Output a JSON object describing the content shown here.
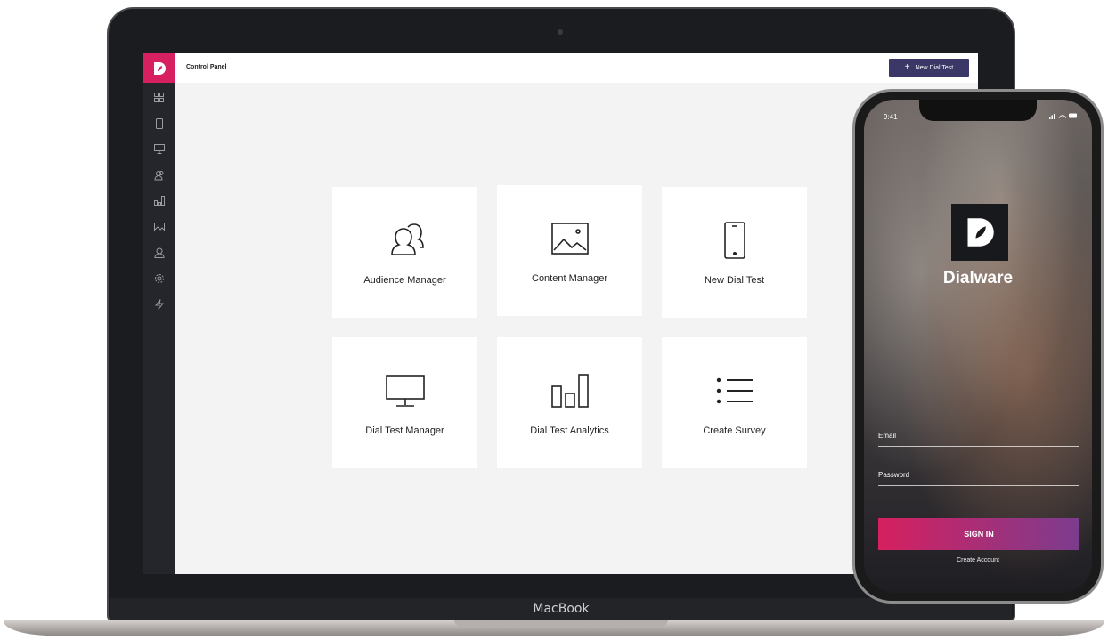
{
  "laptop": {
    "brand_label": "MacBook"
  },
  "app": {
    "header": {
      "title": "Control Panel",
      "new_button_label": "New Dial Test",
      "new_button_icon": "plus-icon"
    },
    "sidebar": {
      "logo_icon": "dialware-logo-icon",
      "icons": [
        "grid-icon",
        "phone-icon",
        "monitor-icon",
        "audience-icon",
        "bar-chart-icon",
        "image-icon",
        "user-icon",
        "gear-icon",
        "bolt-icon"
      ]
    },
    "cards": [
      {
        "label": "Audience Manager",
        "icon": "audience-icon"
      },
      {
        "label": "Content Manager",
        "icon": "image-icon"
      },
      {
        "label": "New Dial Test",
        "icon": "phone-icon"
      },
      {
        "label": "Dial Test Manager",
        "icon": "monitor-icon"
      },
      {
        "label": "Dial Test Analytics",
        "icon": "bar-chart-icon"
      },
      {
        "label": "Create Survey",
        "icon": "list-icon"
      }
    ],
    "colors": {
      "brand": "#d6205f",
      "sidebar": "#25262b",
      "button": "#3b3766",
      "signin_gradient_end": "#7b3c8e"
    }
  },
  "phone": {
    "status_time": "9:41",
    "app_name": "Dialware",
    "email_label": "Email",
    "password_label": "Password",
    "signin_label": "SIGN IN",
    "create_account_label": "Create Account"
  }
}
